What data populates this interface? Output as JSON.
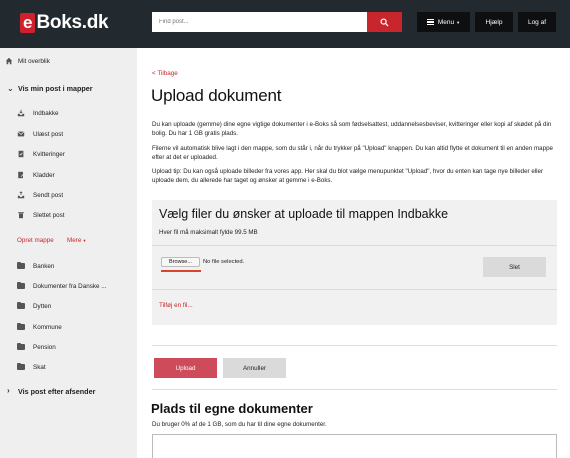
{
  "header": {
    "logo_e": "e",
    "logo_rest": "Boks.dk",
    "search_placeholder": "Find post...",
    "menu_label": "Menu",
    "help_label": "Hjælp",
    "logout_label": "Log af",
    "brand_color": "#c9252c",
    "bar_color": "#222a30"
  },
  "sidebar": {
    "overview": "Mit overblik",
    "by_folder_heading": "Vis min post i mapper",
    "system_folders": [
      {
        "label": "Indbakke",
        "icon": "inbox-icon"
      },
      {
        "label": "Ulæst post",
        "icon": "unread-mail-icon"
      },
      {
        "label": "Kvitteringer",
        "icon": "receipt-icon"
      },
      {
        "label": "Kladder",
        "icon": "draft-icon"
      },
      {
        "label": "Sendt post",
        "icon": "sent-icon"
      },
      {
        "label": "Slettet post",
        "icon": "trash-icon"
      }
    ],
    "create_folder": "Opret mappe",
    "more": "Mere",
    "user_folders": [
      {
        "label": "Banken",
        "icon": "folder-icon"
      },
      {
        "label": "Dokumenter fra Danske ...",
        "icon": "folder-icon"
      },
      {
        "label": "Dytten",
        "icon": "folder-icon"
      },
      {
        "label": "Kommune",
        "icon": "folder-icon"
      },
      {
        "label": "Pension",
        "icon": "folder-icon"
      },
      {
        "label": "Skat",
        "icon": "folder-icon"
      }
    ],
    "by_sender_heading": "Vis post efter afsender"
  },
  "main": {
    "back_link": "< Tilbage",
    "title": "Upload dokument",
    "paragraphs": [
      "Du kan uploade (gemme) dine egne vigtige dokumenter i e-Boks så som fødselsattest, uddannelsesbeviser, kvitteringer eller kopi af skødet på din bolig. Du har 1 GB gratis plads.",
      "Filerne vil automatisk blive lagt i den mappe, som du står i, når du trykker på \"Upload\" knappen. Du kan altid flytte et dokument til en anden mappe efter at det er uploaded.",
      "Upload tip: Du kan også uploade billeder fra vores app. Her skal du blot vælge menupunktet \"Upload\", hvor du enten kan tage nye billeder eller uploade dem, du allerede har taget og ønsker at gemme i e-Boks."
    ],
    "upload_box": {
      "title": "Vælg filer du ønsker at uploade til mappen Indbakke",
      "max_size": "Hver fil må maksimalt fylde 99.5 MB",
      "browse_label": "Browse...",
      "file_status": "No file selected.",
      "delete_label": "Slet",
      "add_file_link": "Tilføj en fil..."
    },
    "upload_label": "Upload",
    "cancel_label": "Annuller",
    "storage_title": "Plads til egne dokumenter",
    "storage_usage": "Du bruger 0% af de 1 GB, som du har til dine egne dokumenter."
  }
}
